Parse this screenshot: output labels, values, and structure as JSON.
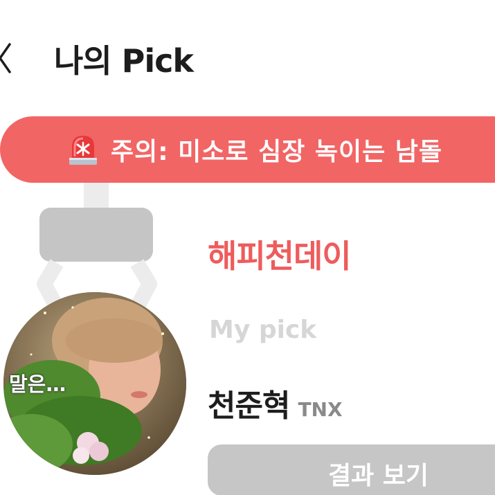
{
  "header": {
    "back_icon": "chevron-left-icon",
    "title": "나의 Pick"
  },
  "banner": {
    "icon": "siren-icon",
    "text": "주의: 미소로 심장 녹이는 남돌"
  },
  "result": {
    "pick_title": "해피천데이",
    "my_pick_label": "My pick",
    "name": "천준혁",
    "group": "TNX",
    "photo_caption": "말은…",
    "button_label": "결과 보기"
  },
  "colors": {
    "accent_red": "#ee5c5c",
    "banner_bg": "#f26565",
    "button_bg": "#c6c6c6",
    "claw_gray": "#c5c5c5"
  }
}
